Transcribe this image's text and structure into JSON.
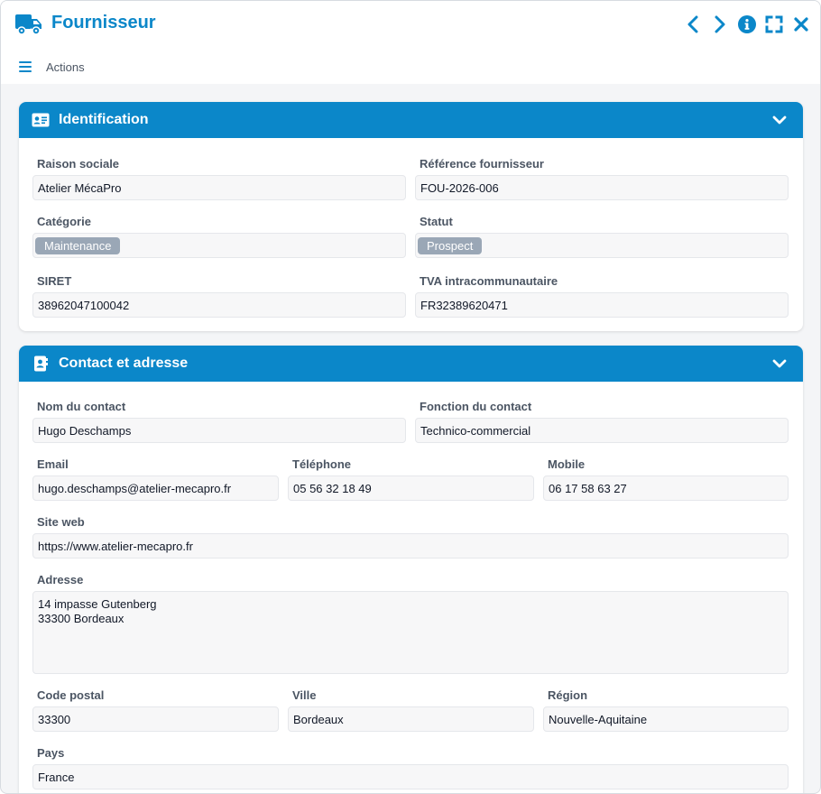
{
  "window": {
    "title": "Fournisseur",
    "title_icon": "truck-icon"
  },
  "title_actions": [
    {
      "name": "previous-icon",
      "icon": "chevron-left"
    },
    {
      "name": "next-icon",
      "icon": "chevron-right"
    },
    {
      "name": "info-icon",
      "icon": "info-circle"
    },
    {
      "name": "fullscreen-icon",
      "icon": "expand"
    },
    {
      "name": "close-icon",
      "icon": "close"
    }
  ],
  "toolbar": {
    "menu_icon": "hamburger-icon",
    "actions_label": "Actions"
  },
  "colors": {
    "accent": "#0b87c9",
    "tag_bg": "#9aa7b6",
    "field_bg": "#f7f7f8"
  },
  "identification": {
    "title": "Identification",
    "icon": "id-card-icon",
    "raison_sociale": {
      "label": "Raison sociale",
      "value": "Atelier MécaPro"
    },
    "reference": {
      "label": "Référence fournisseur",
      "value": "FOU-2026-006"
    },
    "categorie": {
      "label": "Catégorie",
      "tag": "Maintenance"
    },
    "statut": {
      "label": "Statut",
      "tag": "Prospect"
    },
    "siret": {
      "label": "SIRET",
      "value": "38962047100042"
    },
    "tva": {
      "label": "TVA intracommunautaire",
      "value": "FR32389620471"
    }
  },
  "contact": {
    "title": "Contact et adresse",
    "icon": "contact-book-icon",
    "nom": {
      "label": "Nom du contact",
      "value": "Hugo Deschamps"
    },
    "fonction": {
      "label": "Fonction du contact",
      "value": "Technico-commercial"
    },
    "email": {
      "label": "Email",
      "value": "hugo.deschamps@atelier-mecapro.fr"
    },
    "telephone": {
      "label": "Téléphone",
      "value": "05 56 32 18 49"
    },
    "mobile": {
      "label": "Mobile",
      "value": "06 17 58 63 27"
    },
    "site_web": {
      "label": "Site web",
      "value": "https://www.atelier-mecapro.fr"
    },
    "adresse": {
      "label": "Adresse",
      "value": "14 impasse Gutenberg\n33300 Bordeaux"
    },
    "code_postal": {
      "label": "Code postal",
      "value": "33300"
    },
    "ville": {
      "label": "Ville",
      "value": "Bordeaux"
    },
    "region": {
      "label": "Région",
      "value": "Nouvelle-Aquitaine"
    },
    "pays": {
      "label": "Pays",
      "value": "France"
    }
  }
}
